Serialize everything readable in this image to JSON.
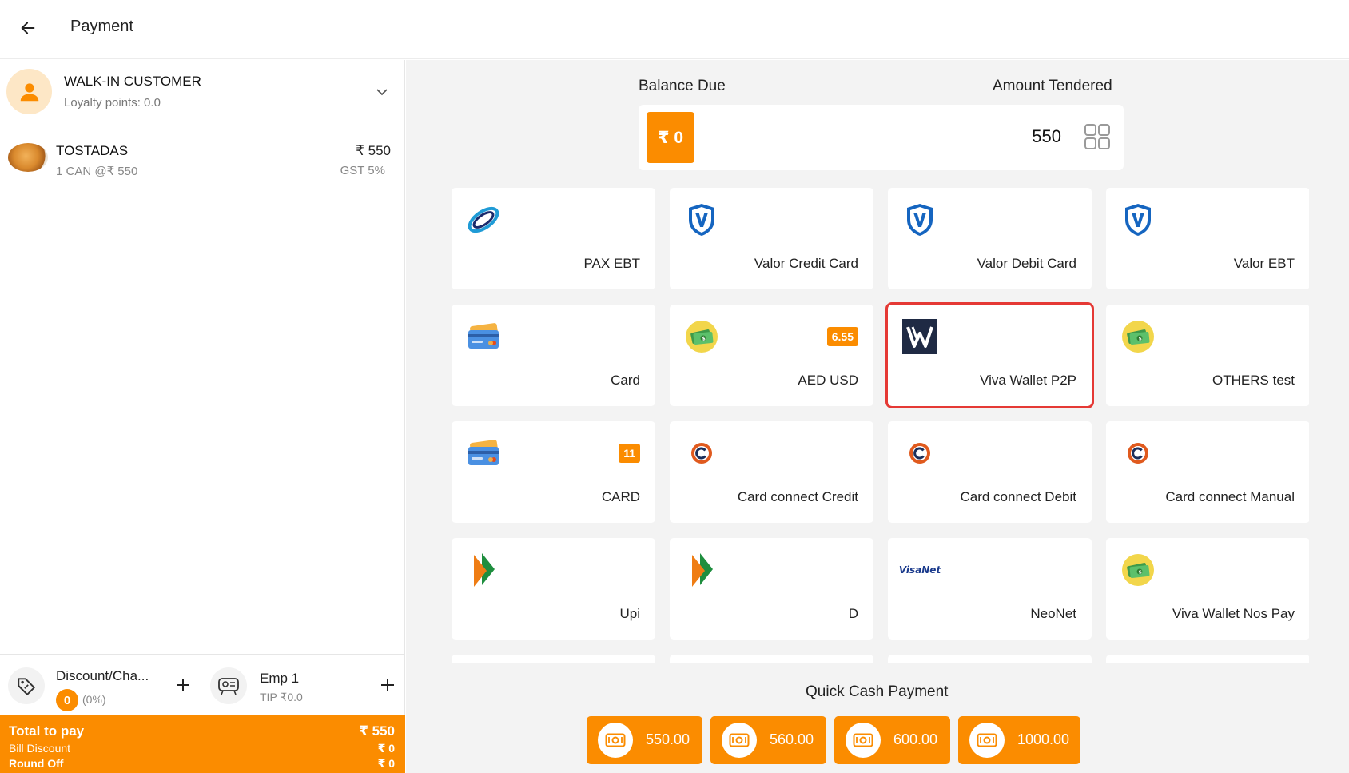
{
  "header": {
    "title": "Payment"
  },
  "customer": {
    "name": "WALK-IN CUSTOMER",
    "loyalty": "Loyalty points: 0.0"
  },
  "cart": {
    "items": [
      {
        "name": "TOSTADAS",
        "qty": "1 CAN @₹ 550",
        "price": "₹ 550",
        "tax": "GST 5%"
      }
    ]
  },
  "discount": {
    "title": "Discount/Cha...",
    "badge": "0",
    "percent": "(0%)"
  },
  "employee": {
    "name": "Emp 1",
    "tip": "TIP ₹0.0"
  },
  "totals": {
    "total_label": "Total to pay",
    "total_value": "₹ 550",
    "discount_label": "Bill Discount",
    "discount_value": "₹ 0",
    "roundoff_label": "Round Off",
    "roundoff_value": "₹ 0"
  },
  "payment": {
    "balance_label": "Balance Due",
    "balance_value": "₹ 0",
    "tendered_label": "Amount Tendered",
    "tendered_value": "550"
  },
  "methods": [
    {
      "label": "PAX EBT",
      "icon": "pax-logo-icon"
    },
    {
      "label": "Valor Credit Card",
      "icon": "valor-shield-icon"
    },
    {
      "label": "Valor Debit Card",
      "icon": "valor-shield-icon"
    },
    {
      "label": "Valor EBT",
      "icon": "valor-shield-icon"
    },
    {
      "label": "Card",
      "icon": "credit-card-icon"
    },
    {
      "label": "AED USD",
      "icon": "cash-icon",
      "badge": "6.55"
    },
    {
      "label": "Viva Wallet P2P",
      "icon": "viva-wallet-icon",
      "selected": true
    },
    {
      "label": "OTHERS test",
      "icon": "cash-icon"
    },
    {
      "label": "CARD",
      "icon": "credit-card-icon",
      "badge": "11"
    },
    {
      "label": "Card connect Credit",
      "icon": "cardconnect-icon"
    },
    {
      "label": "Card connect Debit",
      "icon": "cardconnect-icon"
    },
    {
      "label": "Card connect Manual",
      "icon": "cardconnect-icon"
    },
    {
      "label": "Upi",
      "icon": "upi-icon"
    },
    {
      "label": "D",
      "icon": "upi-icon"
    },
    {
      "label": "NeoNet",
      "icon": "visanet-icon",
      "icon_text": "VisaNet"
    },
    {
      "label": "Viva Wallet Nos Pay",
      "icon": "cash-icon"
    }
  ],
  "quick_cash": {
    "label": "Quick Cash Payment",
    "amounts": [
      "550.00",
      "560.00",
      "600.00",
      "1000.00"
    ]
  },
  "colors": {
    "accent": "#fb8c00",
    "selected_outline": "#e53935",
    "background": "#f3f3f3"
  }
}
